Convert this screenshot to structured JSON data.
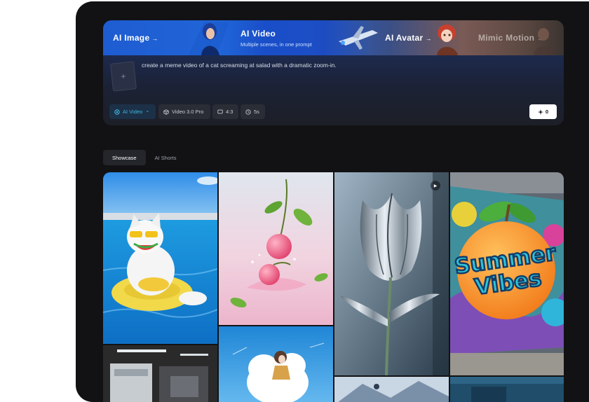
{
  "header_tabs": [
    {
      "label": "AI Image",
      "arrow": "→"
    },
    {
      "label": "AI Video",
      "subtitle": "Multiple scenes, in one prompt"
    },
    {
      "label": "AI Avatar",
      "arrow": "→"
    },
    {
      "label": "Mimic Motion",
      "arrow": "→"
    }
  ],
  "upload": {
    "symbol": "+"
  },
  "prompt": {
    "text": "create a meme video of a cat screaming at salad with a dramatic zoom-in."
  },
  "options": [
    {
      "label": "AI Video",
      "icon": "camera-lens-icon",
      "chevron": "⌄"
    },
    {
      "label": "Video 3.0 Pro",
      "icon": "cube-icon"
    },
    {
      "label": "4:3",
      "icon": "aspect-ratio-icon"
    },
    {
      "label": "5s",
      "icon": "clock-icon"
    }
  ],
  "credits": {
    "icon": "sparkle-icon",
    "value": "0"
  },
  "showcase_tabs": [
    {
      "label": "Showcase",
      "active": true
    },
    {
      "label": "AI Shorts",
      "active": false
    }
  ],
  "gallery": {
    "tiles": [
      "cat-in-pool",
      "cherry-splash",
      "chrome-tulip",
      "summer-vibes-graffiti",
      "workshop",
      "anime-cloud",
      "blue-scene",
      "dark-scene"
    ],
    "summer_text_line1": "Summer",
    "summer_text_line2": "Vibes",
    "play_symbol": "▶"
  },
  "colors": {
    "accent": "#3fb6e0",
    "brand_blue": "#1e5cd1",
    "device": "#121214"
  }
}
